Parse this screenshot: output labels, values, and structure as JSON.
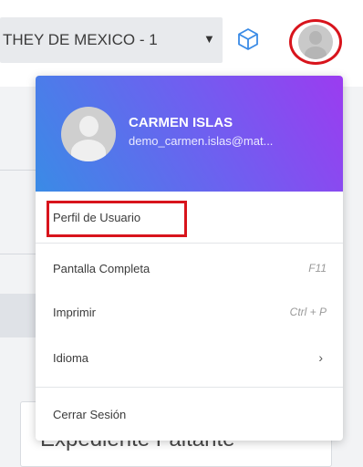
{
  "topbar": {
    "company_select_value": "THEY DE MEXICO - 1",
    "caret_icon": "▼",
    "cube_icon": "cube-icon",
    "avatar_icon": "user-avatar"
  },
  "background": {
    "card_title": "Expediente Faltante"
  },
  "user_menu": {
    "header": {
      "name": "CARMEN ISLAS",
      "email": "demo_carmen.islas@mat..."
    },
    "items": [
      {
        "label": "Perfil de Usuario",
        "shortcut": ""
      },
      {
        "label": "Pantalla Completa",
        "shortcut": "F11"
      },
      {
        "label": "Imprimir",
        "shortcut": "Ctrl + P"
      },
      {
        "label": "Idioma",
        "shortcut": "",
        "submenu_icon": "›"
      },
      {
        "label": "Cerrar Sesión",
        "shortcut": ""
      }
    ]
  },
  "colors": {
    "highlight": "#d8141c",
    "header_gradient_start": "#3a8be6",
    "header_gradient_end": "#9b3cf0"
  }
}
